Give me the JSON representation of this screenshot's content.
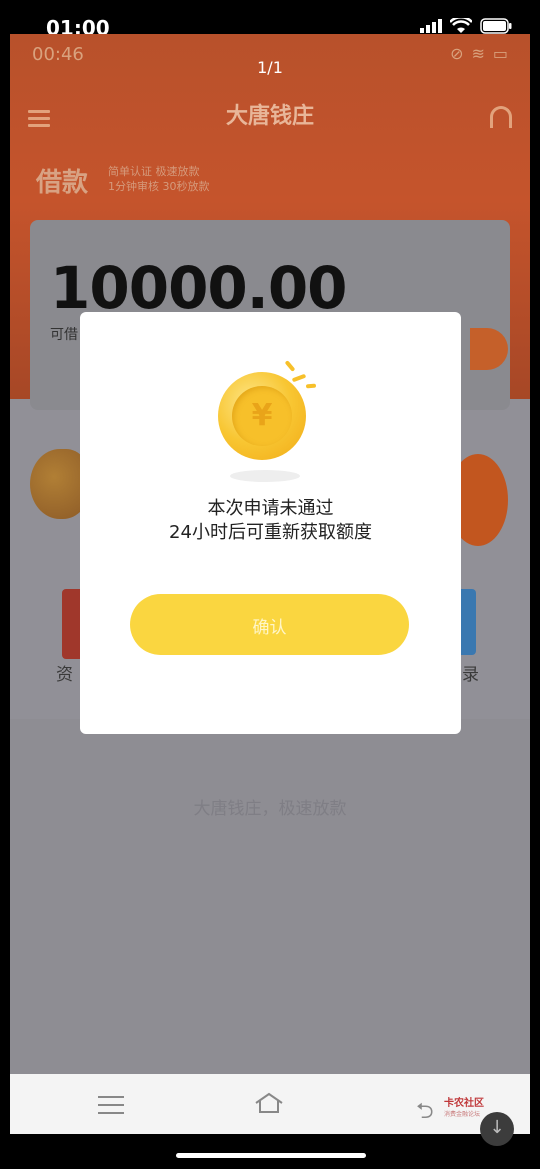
{
  "ios_status": {
    "time": "01:00"
  },
  "viewer": {
    "page_counter": "1/1"
  },
  "inner_status": {
    "time": "00:46"
  },
  "app": {
    "title": "大唐钱庄",
    "loan_label": "借款",
    "tag_line_1": "简单认证 极速放款",
    "tag_line_2": "1分钟审核 30秒放款",
    "amount": "10000.00",
    "amount_caption": "可借",
    "grid_left_label": "资",
    "grid_right_label": "录",
    "footer_slogan": "大唐钱庄，极速放款"
  },
  "dialog": {
    "line1": "本次申请未通过",
    "line2": "24小时后可重新获取额度",
    "confirm_label": "确认"
  },
  "watermark": {
    "text": "卡农社区",
    "sub": "消费金融论坛"
  },
  "colors": {
    "accent": "#fad640",
    "orange": "#c5542c",
    "overlay": "#8e8d93"
  }
}
